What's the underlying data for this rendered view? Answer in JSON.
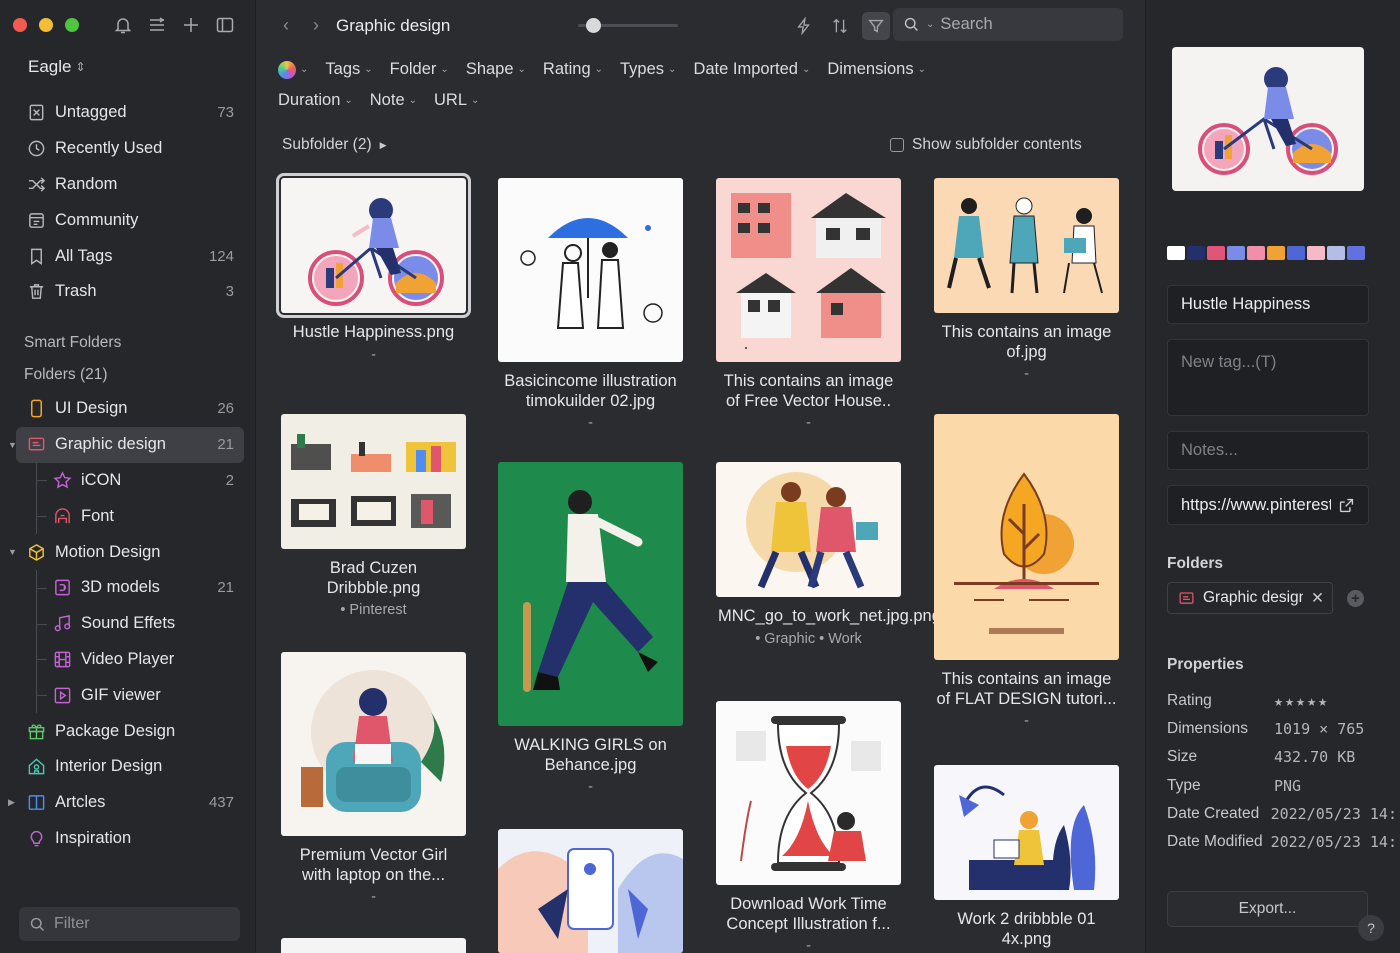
{
  "sidebar": {
    "library_title": "Eagle",
    "library_chevron": "⌃⌄",
    "items": [
      {
        "label": "Untagged",
        "count": "73",
        "icon": "untagged-icon"
      },
      {
        "label": "Recently Used",
        "count": "",
        "icon": "clock-icon"
      },
      {
        "label": "Random",
        "count": "",
        "icon": "shuffle-icon"
      },
      {
        "label": "Community",
        "count": "",
        "icon": "community-icon"
      },
      {
        "label": "All Tags",
        "count": "124",
        "icon": "bookmark-icon"
      },
      {
        "label": "Trash",
        "count": "3",
        "icon": "trash-icon"
      }
    ],
    "smart_folders_label": "Smart Folders",
    "folders_label": "Folders (21)",
    "folders": [
      {
        "label": "UI Design",
        "count": "26",
        "icon": "phone-icon",
        "color": "#f5a623"
      },
      {
        "label": "Graphic design",
        "count": "21",
        "icon": "graphic-folder-icon",
        "color": "#e0566b",
        "active": true
      },
      {
        "label": "iCON",
        "count": "2",
        "icon": "star-icon",
        "color": "#c563d6",
        "sub": true
      },
      {
        "label": "Font",
        "count": "",
        "icon": "font-icon",
        "color": "#e0566b",
        "sub": true
      },
      {
        "label": "Motion Design",
        "count": "",
        "icon": "box-icon",
        "color": "#f0c43a"
      },
      {
        "label": "3D models",
        "count": "21",
        "icon": "3d-icon",
        "color": "#c563d6",
        "sub": true
      },
      {
        "label": "Sound Effets",
        "count": "",
        "icon": "music-icon",
        "color": "#c563d6",
        "sub": true
      },
      {
        "label": "Video Player",
        "count": "",
        "icon": "film-icon",
        "color": "#c563d6",
        "sub": true
      },
      {
        "label": "GIF viewer",
        "count": "",
        "icon": "play-icon",
        "color": "#c563d6",
        "sub": true
      },
      {
        "label": "Package Design",
        "count": "",
        "icon": "gift-icon",
        "color": "#5fc46a"
      },
      {
        "label": "Interior Design",
        "count": "",
        "icon": "home-icon",
        "color": "#4fc4b2"
      },
      {
        "label": "Artcles",
        "count": "437",
        "icon": "book-icon",
        "color": "#4f8df0"
      },
      {
        "label": "Inspiration",
        "count": "",
        "icon": "bulb-icon",
        "color": "#c563d6"
      }
    ],
    "filter_placeholder": "Filter"
  },
  "toolbar": {
    "folder_title": "Graphic design",
    "slider_value": 0.15,
    "search_placeholder": "Search"
  },
  "filters": [
    "Tags",
    "Folder",
    "Shape",
    "Rating",
    "Types",
    "Date Imported",
    "Dimensions",
    "Duration",
    "Note",
    "URL"
  ],
  "subfolder_label": "Subfolder (2)",
  "show_subfolder_label": "Show subfolder contents",
  "items": [
    {
      "title": "Hustle Happiness.png",
      "sub": "-"
    },
    {
      "title": "Brad Cuzen Dribbble.png",
      "sub": "• Pinterest"
    },
    {
      "title": "Premium Vector Girl with laptop on the...",
      "sub": "-"
    },
    {
      "title": "Basicincome illustration timokuilder 02.jpg",
      "sub": "-"
    },
    {
      "title": "WALKING GIRLS on Behance.jpg",
      "sub": "-"
    },
    {
      "title": "This contains an image of Free Vector House..",
      "sub": "-"
    },
    {
      "title": "MNC_go_to_work_net.jpg.png",
      "sub": "• Graphic  • Work"
    },
    {
      "title": "Download Work Time Concept Illustration f...",
      "sub": "-"
    },
    {
      "title": "This contains an image of.jpg",
      "sub": "-"
    },
    {
      "title": "This contains an image of FLAT DESIGN tutori...",
      "sub": "-"
    },
    {
      "title": "Work 2 dribbble 01 4x.png",
      "sub": ""
    }
  ],
  "inspector": {
    "palette": [
      "#ffffff",
      "#23306b",
      "#e0567a",
      "#7b8be8",
      "#f18ea8",
      "#f0a234",
      "#4f67d6",
      "#f6b9c7",
      "#b3bde8",
      "#6271e0"
    ],
    "name": "Hustle Happiness",
    "tags_placeholder": "New tag...(T)",
    "notes_placeholder": "Notes...",
    "url": "https://www.pinterest.com",
    "folders_heading": "Folders",
    "folder_pill": "Graphic design",
    "properties_heading": "Properties",
    "props": [
      {
        "k": "Rating",
        "v": "★★★★★"
      },
      {
        "k": "Dimensions",
        "v": "1019 × 765"
      },
      {
        "k": "Size",
        "v": "432.70 KB"
      },
      {
        "k": "Type",
        "v": "PNG"
      },
      {
        "k": "Date Created",
        "v": "2022/05/23 14:"
      },
      {
        "k": "Date Modified",
        "v": "2022/05/23 14:"
      }
    ],
    "export_label": "Export...",
    "help_label": "?"
  }
}
